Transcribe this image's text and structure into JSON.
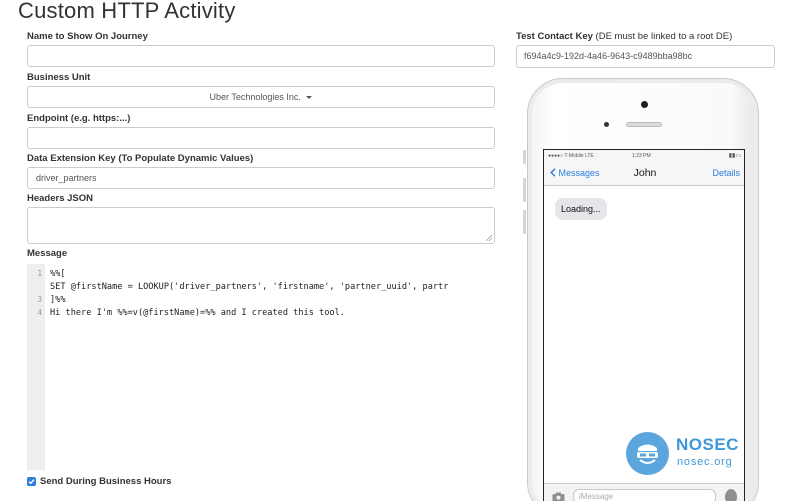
{
  "page": {
    "title": "Custom HTTP Activity"
  },
  "form": {
    "name_label": "Name to Show On Journey",
    "name_value": "",
    "business_unit_label": "Business Unit",
    "business_unit_value": "Uber Technologies Inc.",
    "endpoint_label": "Endpoint (e.g. https:...)",
    "endpoint_value": "",
    "de_key_label": "Data Extension Key (To Populate Dynamic Values)",
    "de_key_value": "driver_partners",
    "headers_label": "Headers JSON",
    "headers_value": "",
    "message_label": "Message",
    "message_lines": [
      {
        "num": "1",
        "text": "%%["
      },
      {
        "num": "",
        "text": "SET @firstName = LOOKUP('driver_partners', 'firstname', 'partner_uuid', partr"
      },
      {
        "num": "3",
        "text": "]%%"
      },
      {
        "num": "4",
        "text": "Hi there I'm %%=v(@firstName)=%% and I created this tool."
      }
    ],
    "business_hours_label": "Send During Business Hours",
    "business_hours_checked": true
  },
  "test_contact": {
    "label_bold": "Test Contact Key",
    "label_note": " (DE must be linked to a root DE)",
    "value": "f694a4c9-192d-4a46-9643-c9489bba98bc"
  },
  "phone": {
    "status_carrier": "●●●●○ T-Mobile  LTE",
    "status_time": "1:23 PM",
    "status_battery": "▮▮▭",
    "back_label": "Messages",
    "contact_name": "John",
    "details_label": "Details",
    "bubble_text": "Loading...",
    "input_placeholder": "iMessage"
  },
  "watermark": {
    "brand": "NOSEC",
    "domain": "nosec.org"
  },
  "colors": {
    "accent": "#2a7de1",
    "checkbox": "#2f7ed8",
    "watermark": "#3f98d8"
  }
}
